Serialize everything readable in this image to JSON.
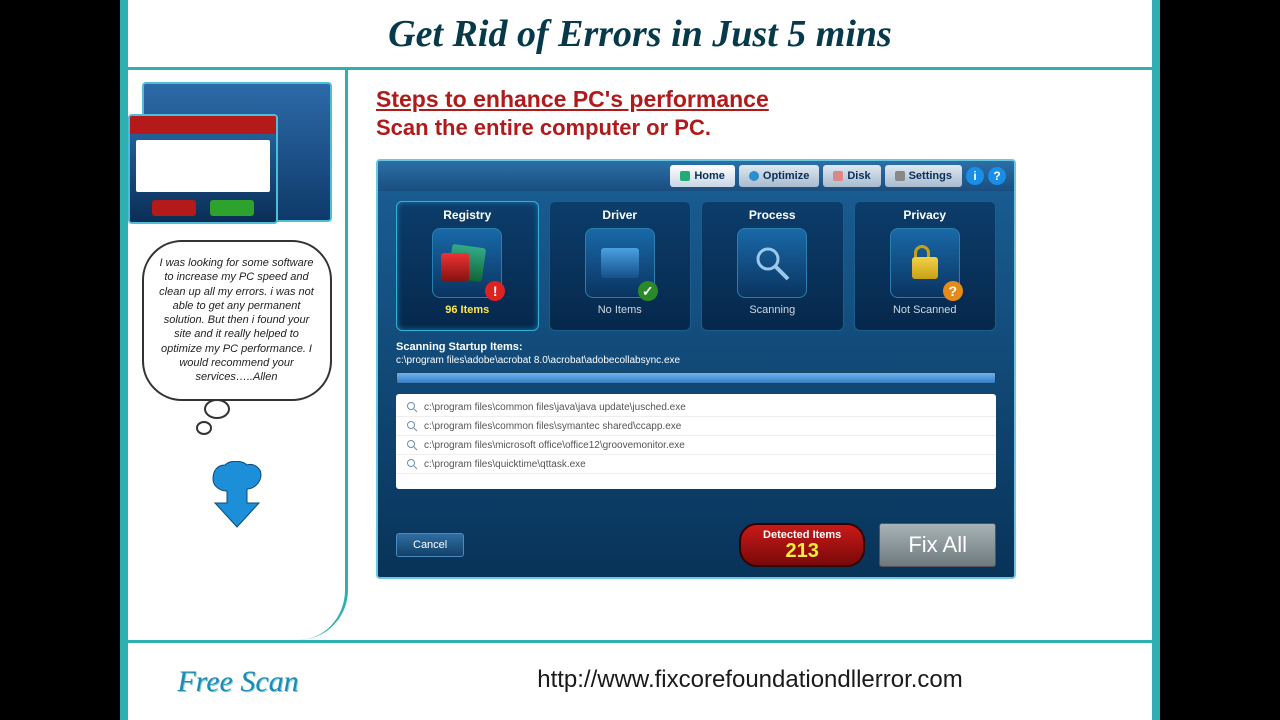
{
  "headline": "Get Rid of Errors in Just 5 mins",
  "sidebar": {
    "testimonial": "I was looking for some software to increase my PC speed and clean up all my errors. i was not able to get any permanent solution. But then i found your site and it really helped to optimize my PC performance. I would recommend your services…..Allen",
    "cta": "Free Scan"
  },
  "main": {
    "steps_title": "Steps to enhance PC's performance",
    "subtitle": "Scan the entire computer or PC."
  },
  "app": {
    "tabs": {
      "home": "Home",
      "optimize": "Optimize",
      "disk": "Disk",
      "settings": "Settings"
    },
    "tiles": [
      {
        "title": "Registry",
        "status": "96 Items",
        "status_class": ""
      },
      {
        "title": "Driver",
        "status": "No Items",
        "status_class": "gray"
      },
      {
        "title": "Process",
        "status": "Scanning",
        "status_class": "gray"
      },
      {
        "title": "Privacy",
        "status": "Not Scanned",
        "status_class": "gray"
      }
    ],
    "scanning_label": "Scanning Startup Items:",
    "scanning_path": "c:\\program files\\adobe\\acrobat 8.0\\acrobat\\adobecollabsync.exe",
    "files": [
      "c:\\program files\\common files\\java\\java update\\jusched.exe",
      "c:\\program files\\common files\\symantec shared\\ccapp.exe",
      "c:\\program files\\microsoft office\\office12\\groovemonitor.exe",
      "c:\\program files\\quicktime\\qttask.exe"
    ],
    "cancel": "Cancel",
    "detected_label": "Detected Items",
    "detected_count": "213",
    "fix_all": "Fix All"
  },
  "footer": {
    "url": "http://www.fixcorefoundationdllerror.com"
  }
}
